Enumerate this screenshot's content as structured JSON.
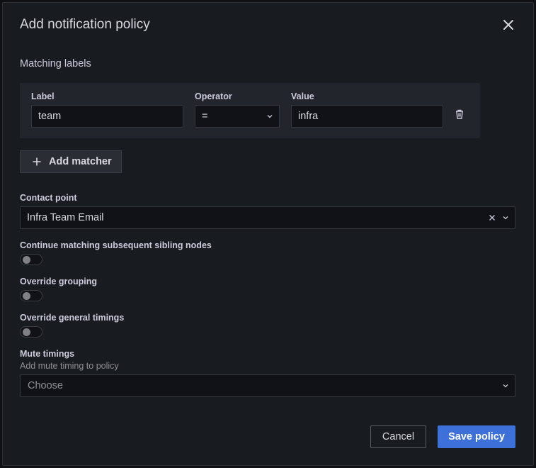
{
  "modal": {
    "title": "Add notification policy"
  },
  "matching": {
    "section_title": "Matching labels",
    "label_header": "Label",
    "operator_header": "Operator",
    "value_header": "Value",
    "matchers": [
      {
        "label": "team",
        "operator": "=",
        "value": "infra"
      }
    ],
    "add_button": "Add matcher"
  },
  "contact_point": {
    "label": "Contact point",
    "value": "Infra Team Email"
  },
  "toggles": [
    {
      "label": "Continue matching subsequent sibling nodes",
      "on": false
    },
    {
      "label": "Override grouping",
      "on": false
    },
    {
      "label": "Override general timings",
      "on": false
    }
  ],
  "mute_timings": {
    "label": "Mute timings",
    "description": "Add mute timing to policy",
    "placeholder": "Choose"
  },
  "footer": {
    "cancel": "Cancel",
    "save": "Save policy"
  },
  "icons": {
    "close": "close-icon",
    "trash": "trash-icon",
    "plus": "plus-icon",
    "chevron": "chevron-down-icon",
    "clear": "clear-icon"
  },
  "colors": {
    "primary": "#3d71d9",
    "background": "#181b1f",
    "panel": "#22252b"
  }
}
